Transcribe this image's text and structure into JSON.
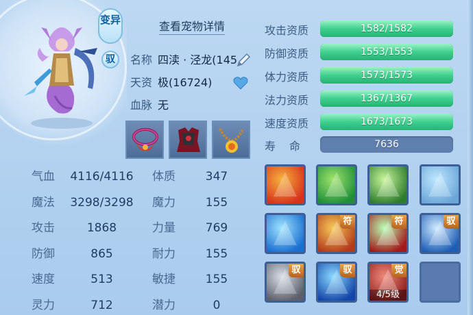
{
  "header": {
    "detail_link": "查看宠物详情"
  },
  "badges": {
    "variant": "变异",
    "tame": "驭"
  },
  "pet": {
    "name_label": "名称",
    "name_value": "四渎 · 泾龙(145",
    "aptitude_label": "天资",
    "aptitude_value": "极(16724)",
    "bloodline_label": "血脉",
    "bloodline_value": "无"
  },
  "stats": [
    {
      "label": "气血",
      "value": "4116/4116"
    },
    {
      "label": "魔法",
      "value": "3298/3298"
    },
    {
      "label": "攻击",
      "value": "1868"
    },
    {
      "label": "防御",
      "value": "865"
    },
    {
      "label": "速度",
      "value": "513"
    },
    {
      "label": "灵力",
      "value": "712"
    }
  ],
  "attributes": [
    {
      "label": "体质",
      "value": "347"
    },
    {
      "label": "魔力",
      "value": "155"
    },
    {
      "label": "力量",
      "value": "769"
    },
    {
      "label": "耐力",
      "value": "155"
    },
    {
      "label": "敏捷",
      "value": "155"
    },
    {
      "label": "潜力",
      "value": "0"
    }
  ],
  "aptitudes": [
    {
      "label": "攻击资质",
      "value": "1582/1582",
      "fill": 1.0
    },
    {
      "label": "防御资质",
      "value": "1553/1553",
      "fill": 1.0
    },
    {
      "label": "体力资质",
      "value": "1573/1573",
      "fill": 1.0
    },
    {
      "label": "法力资质",
      "value": "1367/1367",
      "fill": 1.0
    },
    {
      "label": "速度资质",
      "value": "1673/1673",
      "fill": 1.0
    }
  ],
  "life": {
    "label": "寿命",
    "value": "7636"
  },
  "skills": [
    {
      "icon": "flame-sword-icon",
      "tag": ""
    },
    {
      "icon": "green-warrior-icon",
      "tag": ""
    },
    {
      "icon": "shadow-strike-icon",
      "tag": ""
    },
    {
      "icon": "spirit-hand-icon",
      "tag": ""
    },
    {
      "icon": "water-wave-icon",
      "tag": ""
    },
    {
      "icon": "golden-blade-icon",
      "tag": "符"
    },
    {
      "icon": "blood-claw-icon",
      "tag": "符"
    },
    {
      "icon": "shield-icon",
      "tag": "驭"
    },
    {
      "icon": "steel-spike-icon",
      "tag": "驭"
    },
    {
      "icon": "blue-vortex-icon",
      "tag": "驭"
    },
    {
      "icon": "awaken-figure-icon",
      "tag": "觉",
      "level": "4/5级"
    },
    {
      "icon": "empty-slot",
      "tag": ""
    }
  ],
  "colors": {
    "bar_fill": "#3fcf8e",
    "bar_track": "#5f7fae",
    "tag": "#d98a35"
  }
}
